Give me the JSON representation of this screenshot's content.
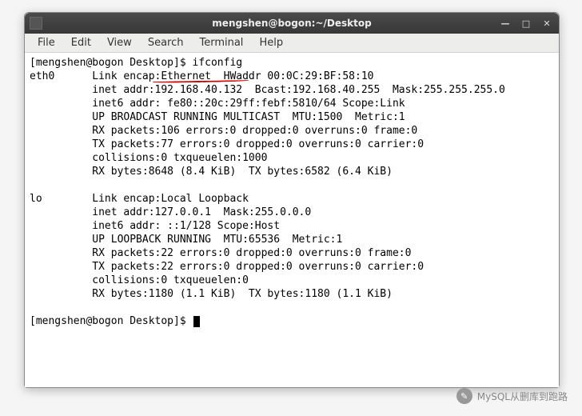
{
  "titlebar": {
    "title": "mengshen@bogon:~/Desktop"
  },
  "menubar": {
    "items": [
      "File",
      "Edit",
      "View",
      "Search",
      "Terminal",
      "Help"
    ]
  },
  "terminal": {
    "prompt1": "[mengshen@bogon Desktop]$ ",
    "cmd1": "ifconfig",
    "lines": [
      "eth0      Link encap:Ethernet  HWaddr 00:0C:29:BF:58:10",
      "          inet addr:192.168.40.132  Bcast:192.168.40.255  Mask:255.255.255.0",
      "          inet6 addr: fe80::20c:29ff:febf:5810/64 Scope:Link",
      "          UP BROADCAST RUNNING MULTICAST  MTU:1500  Metric:1",
      "          RX packets:106 errors:0 dropped:0 overruns:0 frame:0",
      "          TX packets:77 errors:0 dropped:0 overruns:0 carrier:0",
      "          collisions:0 txqueuelen:1000",
      "          RX bytes:8648 (8.4 KiB)  TX bytes:6582 (6.4 KiB)",
      "",
      "lo        Link encap:Local Loopback",
      "          inet addr:127.0.0.1  Mask:255.0.0.0",
      "          inet6 addr: ::1/128 Scope:Host",
      "          UP LOOPBACK RUNNING  MTU:65536  Metric:1",
      "          RX packets:22 errors:0 dropped:0 overruns:0 frame:0",
      "          TX packets:22 errors:0 dropped:0 overruns:0 carrier:0",
      "          collisions:0 txqueuelen:0",
      "          RX bytes:1180 (1.1 KiB)  TX bytes:1180 (1.1 KiB)",
      ""
    ],
    "prompt2": "[mengshen@bogon Desktop]$ "
  },
  "watermark": {
    "text": "MySQL从删库到跑路"
  },
  "highlight": {
    "ip": "192.168.40.132"
  }
}
